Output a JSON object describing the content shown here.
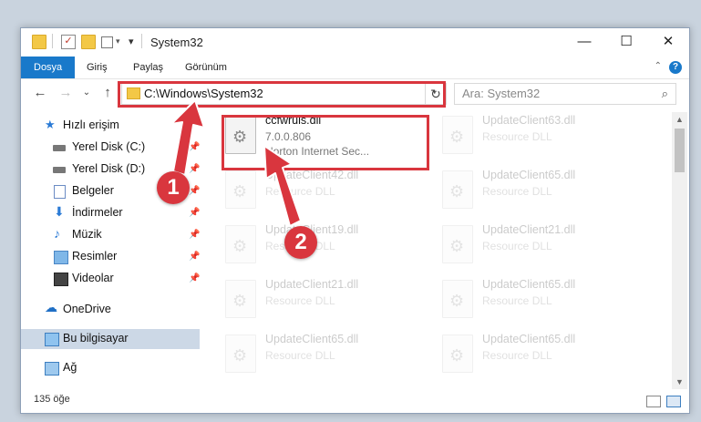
{
  "window": {
    "title": "System32",
    "controls": {
      "minimize": "—",
      "maximize": "☐",
      "close": "✕"
    }
  },
  "ribbon": {
    "tabs": [
      {
        "label": "Dosya",
        "active": true
      },
      {
        "label": "Giriş"
      },
      {
        "label": "Paylaş"
      },
      {
        "label": "Görünüm"
      }
    ],
    "help": "?"
  },
  "nav": {
    "back": "←",
    "forward": "→",
    "recent": "⌄",
    "up": "↑",
    "address": "C:\\Windows\\System32",
    "refresh": "↻",
    "search_placeholder": "Ara: System32",
    "search_icon": "⌕"
  },
  "sidebar": {
    "items": [
      {
        "label": "Hızlı erişim",
        "icon": "star-icon",
        "pinned": false
      },
      {
        "label": "Yerel Disk (C:)",
        "icon": "drive-icon",
        "pinned": true
      },
      {
        "label": "Yerel Disk (D:)",
        "icon": "drive-icon",
        "pinned": true
      },
      {
        "label": "Belgeler",
        "icon": "documents-icon",
        "pinned": true
      },
      {
        "label": "İndirmeler",
        "icon": "download-icon",
        "pinned": true
      },
      {
        "label": "Müzik",
        "icon": "music-icon",
        "pinned": true
      },
      {
        "label": "Resimler",
        "icon": "pictures-icon",
        "pinned": true
      },
      {
        "label": "Videolar",
        "icon": "video-icon",
        "pinned": true
      },
      {
        "label": "OneDrive",
        "icon": "cloud-icon",
        "pinned": false
      },
      {
        "label": "Bu bilgisayar",
        "icon": "computer-icon",
        "pinned": false,
        "selected": true
      },
      {
        "label": "Ağ",
        "icon": "network-icon",
        "pinned": false
      }
    ]
  },
  "files": [
    {
      "name": "ccfwruls.dll",
      "line2": "7.0.0.806",
      "line3": "Norton Internet Sec...",
      "highlighted": true
    },
    {
      "name": "UpdateClient63.dll",
      "line2": "Resource DLL"
    },
    {
      "name": "UpdateClient42.dll",
      "line2": "Resource DLL"
    },
    {
      "name": "UpdateClient65.dll",
      "line2": "Resource DLL"
    },
    {
      "name": "UpdateClient19.dll",
      "line2": "Resource DLL"
    },
    {
      "name": "UpdateClient21.dll",
      "line2": "Resource DLL"
    },
    {
      "name": "UpdateClient21.dll",
      "line2": "Resource DLL"
    },
    {
      "name": "UpdateClient65.dll",
      "line2": "Resource DLL"
    },
    {
      "name": "UpdateClient65.dll",
      "line2": "Resource DLL"
    },
    {
      "name": "UpdateClient65.dll",
      "line2": "Resource DLL"
    }
  ],
  "status": {
    "item_count": "135 öğe"
  },
  "annotations": {
    "step1": "1",
    "step2": "2",
    "color": "#d9363e"
  }
}
